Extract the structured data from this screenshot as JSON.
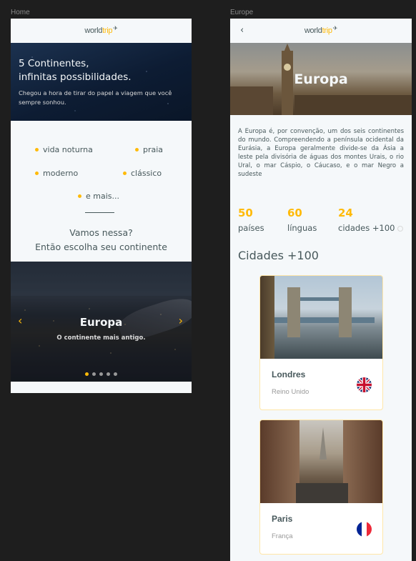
{
  "frames": {
    "home_label": "Home",
    "europe_label": "Europe"
  },
  "logo": {
    "prefix": "world",
    "highlight": "trip"
  },
  "colors": {
    "accent": "#FFBA08",
    "text": "#47585B",
    "background": "#F5F8FA"
  },
  "home": {
    "hero": {
      "title_line1": "5 Continentes,",
      "title_line2": "infinitas possibilidades.",
      "subtitle": "Chegou a hora de tirar do papel a viagem que você sempre sonhou."
    },
    "travel_types": [
      {
        "label": "vida noturna"
      },
      {
        "label": "praia"
      },
      {
        "label": "moderno"
      },
      {
        "label": "clássico"
      },
      {
        "label": "e mais..."
      }
    ],
    "cta": {
      "line1": "Vamos nessa?",
      "line2": "Então escolha seu continente"
    },
    "carousel": {
      "title": "Europa",
      "subtitle": "O continente mais antigo.",
      "slide_count": 5,
      "active_slide": 1
    }
  },
  "continent": {
    "banner_title": "Europa",
    "description": "A Europa é, por convenção, um dos seis continentes do mundo. Compreendendo a península ocidental da Eurásia, a Europa geralmente divide-se da Ásia a leste pela divisória de águas dos montes Urais, o rio Ural, o mar Cáspio, o Cáucaso, e o mar Negro a sudeste",
    "stats": [
      {
        "value": "50",
        "label": "países"
      },
      {
        "value": "60",
        "label": "línguas"
      },
      {
        "value": "24",
        "label": "cidades +100"
      }
    ],
    "cities_title": "Cidades +100",
    "cities": [
      {
        "name": "Londres",
        "country": "Reino Unido",
        "flag": "uk-flag-icon"
      },
      {
        "name": "Paris",
        "country": "França",
        "flag": "france-flag-icon"
      }
    ]
  }
}
